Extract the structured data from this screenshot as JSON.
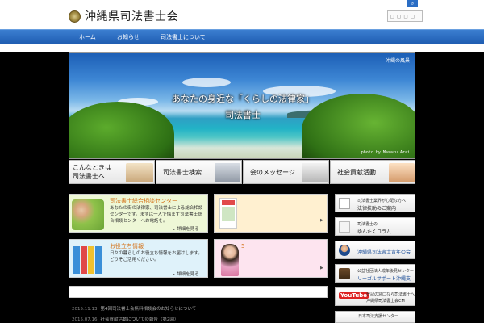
{
  "header": {
    "site_title": "沖縄県司法書士会",
    "search_placeholder": "",
    "search_button": ""
  },
  "nav": {
    "items": [
      {
        "label": "ホーム"
      },
      {
        "label": "お知らせ"
      },
      {
        "label": "司法書士について"
      }
    ]
  },
  "hero": {
    "tag": "沖縄の風景",
    "title": "あなたの身近な「くらしの法律家」",
    "subtitle": "司法書士",
    "credit": "photo by Masaru Arai"
  },
  "banners": [
    {
      "line1": "こんなときは",
      "line2": "司法書士へ"
    },
    {
      "label": "司法書士検索"
    },
    {
      "label": "会のメッセージ"
    },
    {
      "label": "社会貢献活動"
    }
  ],
  "cards": {
    "consult": {
      "title": "司法書士総合相談センター",
      "text": "あなたの街の法律家、司法書士による総合相談センターです。まずは一人で悩まず司法書士総合相談センターへお電話を。",
      "more": "詳細を見る"
    },
    "tips": {
      "title": "お役立ち情報",
      "text": "日々の暮らしのお役立ち情報をお届けします。どうぞご活用ください。",
      "more": "詳細を見る"
    },
    "pink_number": "5"
  },
  "sidebar": [
    {
      "line1": "司法書士業界が心配な方へ",
      "line2": "法律扶助のご案内"
    },
    {
      "line1": "司法書士の",
      "line2": "ゆんたくコラム"
    },
    {
      "big": "沖縄県司法書士青年の会"
    },
    {
      "line1": "公益社団法人成年後見センター",
      "line2": "リーガルサポート沖縄支部"
    },
    {
      "logo": "YouTube",
      "line1": "登記の窓口なら司法書士へ",
      "line2": "沖縄県司法書士会CM"
    },
    {
      "line1": "日本司法支援センター"
    }
  ],
  "news": [
    {
      "date": "2015.11.13",
      "text": "第4回司法書士会無料相談会のお知らせについて"
    },
    {
      "date": "2015.07.16",
      "text": "社会貢献活動についての報告（第2回）"
    }
  ],
  "colors": {
    "nav_blue": "#1d5bb0",
    "accent_orange": "#d4731a",
    "side_blue": "#1a4d98",
    "card_green": "#eef7d6",
    "card_orange": "#fff0d0",
    "card_blue": "#dff2fa",
    "card_pink": "#fde4ef"
  }
}
